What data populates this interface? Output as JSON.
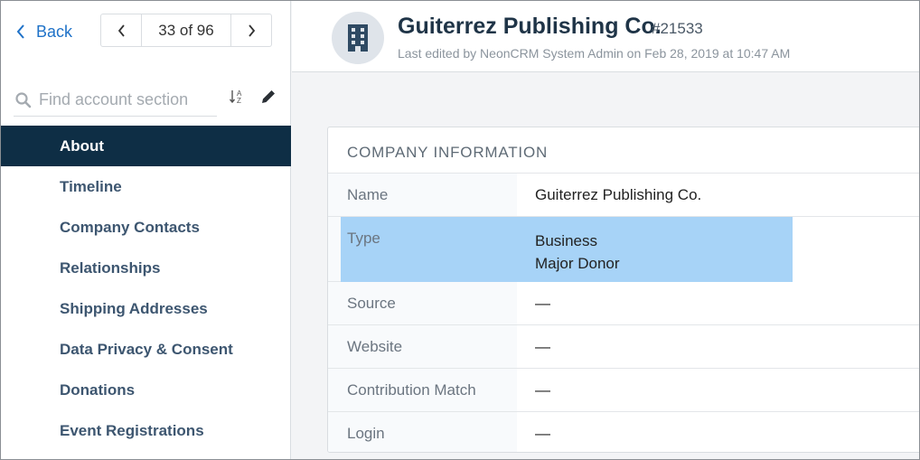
{
  "sidebar": {
    "back_label": "Back",
    "pager_count": "33 of 96",
    "search_placeholder": "Find account section",
    "items": [
      {
        "label": "About",
        "active": true
      },
      {
        "label": "Timeline"
      },
      {
        "label": "Company Contacts"
      },
      {
        "label": "Relationships"
      },
      {
        "label": "Shipping Addresses"
      },
      {
        "label": "Data Privacy & Consent"
      },
      {
        "label": "Donations"
      },
      {
        "label": "Event Registrations"
      }
    ]
  },
  "header": {
    "account_name": "Guiterrez Publishing Co.",
    "account_id": "#21533",
    "last_edited": "Last edited by NeonCRM System Admin on Feb 28, 2019 at 10:47 AM"
  },
  "card": {
    "title": "COMPANY INFORMATION",
    "rows": [
      {
        "label": "Name",
        "value": "Guiterrez Publishing Co."
      },
      {
        "label": "Type",
        "value_line1": "Business",
        "value_line2": "Major Donor"
      },
      {
        "label": "Source",
        "value": "—"
      },
      {
        "label": "Website",
        "value": "—"
      },
      {
        "label": "Contribution Match",
        "value": "—"
      },
      {
        "label": "Login",
        "value": "—"
      }
    ]
  },
  "colors": {
    "accent": "#1f72c8",
    "nav_active_bg": "#0e2e45",
    "highlight": "#a7d3f7"
  },
  "icons": [
    "chevron-left-icon",
    "chevron-right-icon",
    "search-icon",
    "sort-alpha-icon",
    "pencil-icon",
    "building-icon"
  ]
}
